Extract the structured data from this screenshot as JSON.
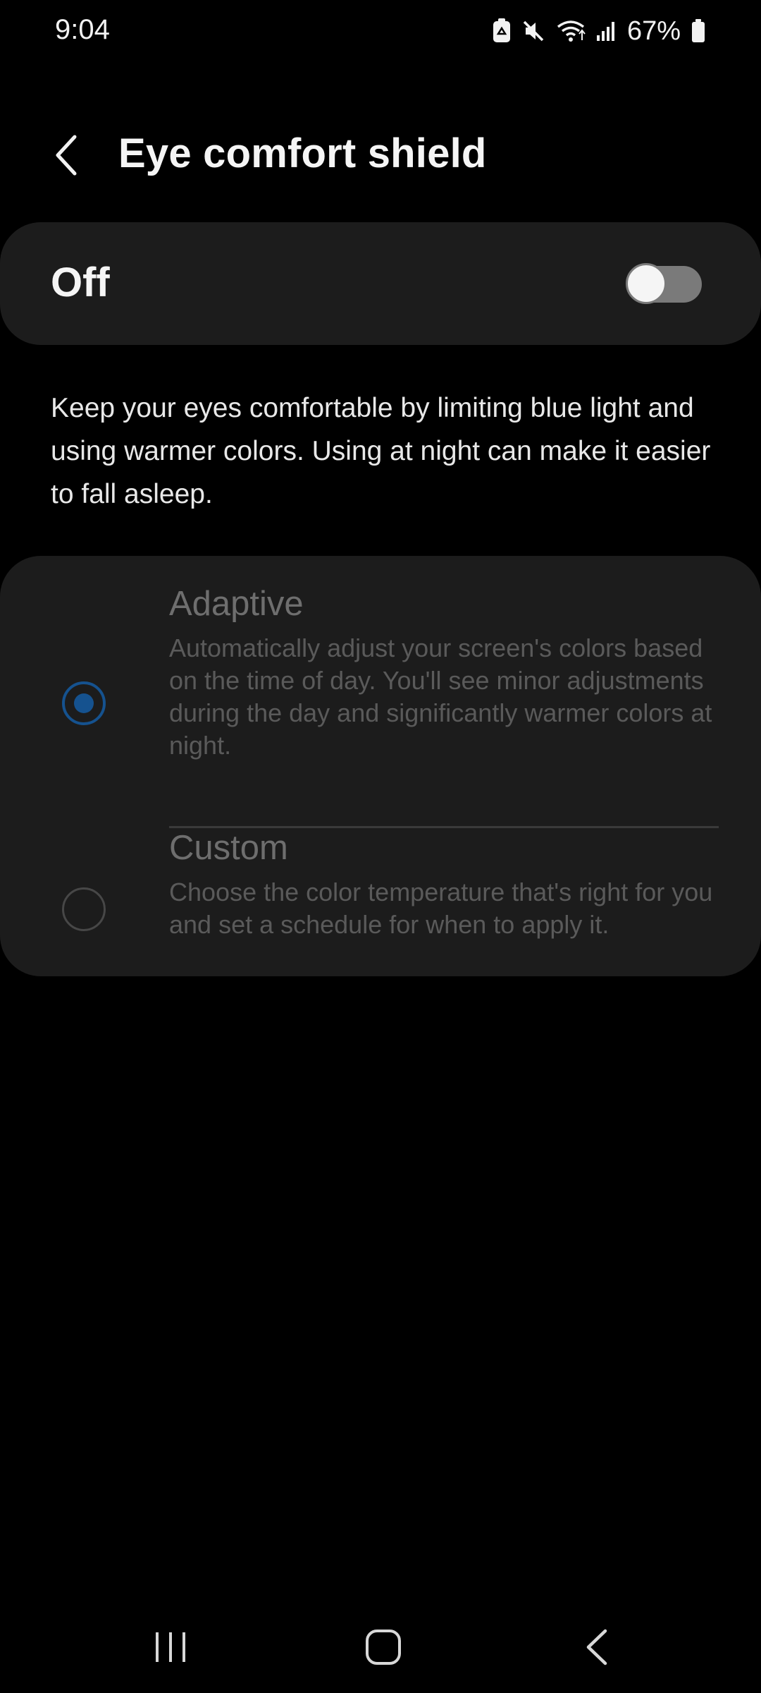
{
  "status_bar": {
    "time": "9:04",
    "battery_percent": "67%",
    "icons": [
      "recycle-icon",
      "mute-icon",
      "wifi-icon",
      "signal-icon",
      "battery-icon"
    ]
  },
  "header": {
    "title": "Eye comfort shield",
    "back_icon": "chevron-left-icon"
  },
  "master_switch": {
    "label": "Off",
    "state": false
  },
  "description": "Keep your eyes comfortable by limiting blue light and using warmer colors. Using at night can make it easier to fall asleep.",
  "options": [
    {
      "title": "Adaptive",
      "description": "Automatically adjust your screen's colors based on the time of day. You'll see minor adjustments during the day and significantly warmer colors at night.",
      "selected": true
    },
    {
      "title": "Custom",
      "description": "Choose the color temperature that's right for you and set a schedule for when to apply it.",
      "selected": false
    }
  ],
  "nav_bar": {
    "buttons": [
      "recents-icon",
      "home-icon",
      "back-icon"
    ]
  },
  "colors": {
    "background": "#000000",
    "card": "#1c1c1c",
    "accent_disabled": "#15528f",
    "toggle_off": "#7a7a7a"
  }
}
